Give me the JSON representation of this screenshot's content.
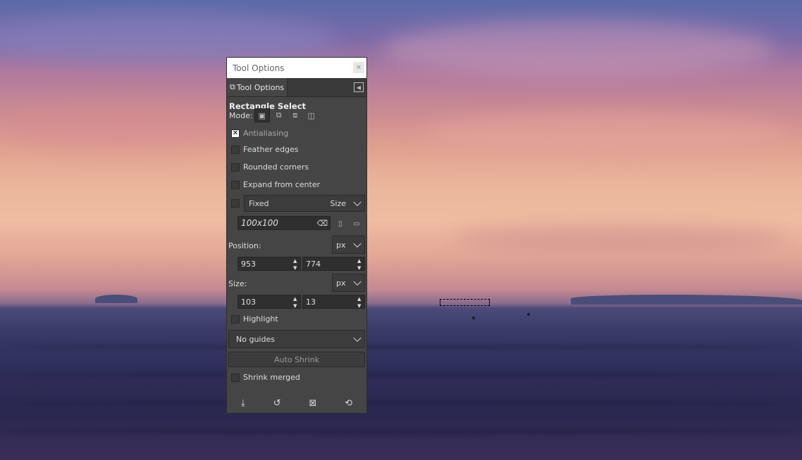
{
  "window": {
    "title": "Tool Options"
  },
  "tab": {
    "label": "Tool Options"
  },
  "tool": {
    "name": "Rectangle Select"
  },
  "mode": {
    "label": "Mode:"
  },
  "options": {
    "antialiasing": {
      "label": "Antialiasing",
      "checked": true
    },
    "feather_edges": {
      "label": "Feather edges",
      "checked": false
    },
    "rounded_corners": {
      "label": "Rounded corners",
      "checked": false
    },
    "expand_from_center": {
      "label": "Expand from center",
      "checked": false
    },
    "highlight": {
      "label": "Highlight",
      "checked": false
    },
    "shrink_merged": {
      "label": "Shrink merged",
      "checked": false
    }
  },
  "fixed": {
    "label": "Fixed",
    "mode": "Size",
    "value": "100x100"
  },
  "position": {
    "label": "Position:",
    "unit": "px",
    "x": "953",
    "y": "774"
  },
  "size": {
    "label": "Size:",
    "unit": "px",
    "w": "103",
    "h": "13"
  },
  "guides": {
    "selected": "No guides"
  },
  "auto_shrink": {
    "label": "Auto Shrink"
  },
  "icons": {
    "close": "close-icon",
    "tab": "tool-options-icon",
    "tab_menu": "tab-menu-icon",
    "footer": [
      "save-icon",
      "restore-icon",
      "delete-icon",
      "reset-icon"
    ]
  }
}
